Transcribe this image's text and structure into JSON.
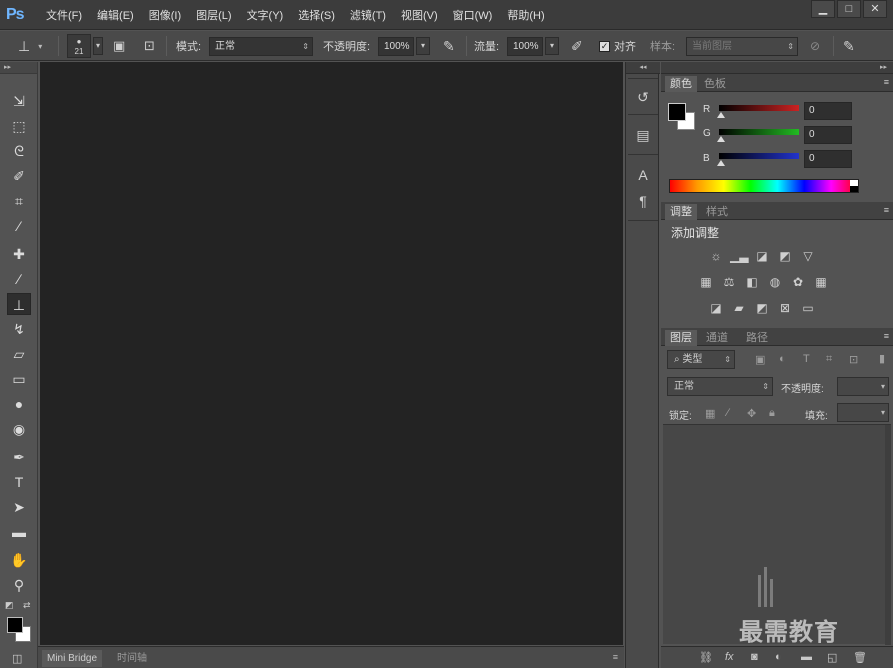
{
  "app": {
    "logo": "Ps"
  },
  "menu": [
    "文件(F)",
    "编辑(E)",
    "图像(I)",
    "图层(L)",
    "文字(Y)",
    "选择(S)",
    "滤镜(T)",
    "视图(V)",
    "窗口(W)",
    "帮助(H)"
  ],
  "window_controls": {
    "minimize": "▁",
    "maximize": "□",
    "close": "✕"
  },
  "options": {
    "brush_size": "21",
    "mode_label": "模式:",
    "mode_value": "正常",
    "opacity_label": "不透明度:",
    "opacity_value": "100%",
    "flow_label": "流量:",
    "flow_value": "100%",
    "align_label": "对齐",
    "sample_label": "样本:",
    "sample_value": "当前图层"
  },
  "bottom_tabs": [
    "Mini Bridge",
    "时间轴"
  ],
  "color_panel": {
    "tabs": [
      "颜色",
      "色板"
    ],
    "channels": [
      {
        "label": "R",
        "value": "0",
        "color": "#cc2222"
      },
      {
        "label": "G",
        "value": "0",
        "color": "#22bb22"
      },
      {
        "label": "B",
        "value": "0",
        "color": "#2233cc"
      }
    ]
  },
  "adjust_panel": {
    "tabs": [
      "调整",
      "样式"
    ],
    "title": "添加调整"
  },
  "layers_panel": {
    "tabs": [
      "图层",
      "通道",
      "路径"
    ],
    "filter_value": "类型",
    "blend_value": "正常",
    "opacity_label": "不透明度:",
    "lock_label": "锁定:",
    "fill_label": "填充:"
  },
  "watermark": "最需教育"
}
